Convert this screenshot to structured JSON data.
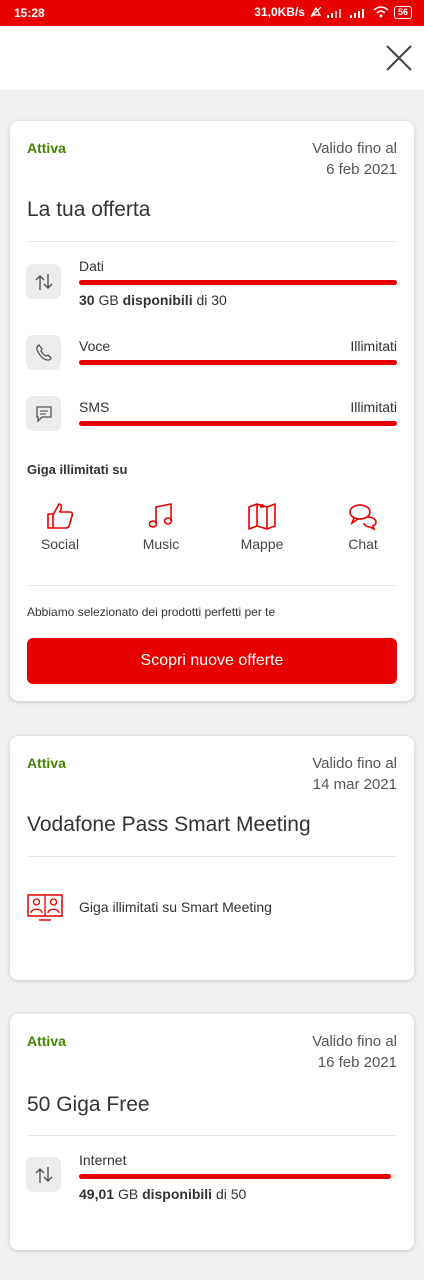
{
  "status_bar": {
    "time": "15:28",
    "speed": "31,0KB/s",
    "battery": "56"
  },
  "offers": [
    {
      "status": "Attiva",
      "valid_label": "Valido fino al",
      "valid_date": "6 feb 2021",
      "title": "La tua offerta",
      "usage": [
        {
          "label": "Dati",
          "amount": "30",
          "unit": "GB",
          "available_text": "disponibili",
          "of_text": "di 30",
          "fill_fraction": 1.0,
          "icon": "data-transfer-icon"
        },
        {
          "label": "Voce",
          "right_value": "Illimitati",
          "fill_fraction": 1.0,
          "icon": "phone-icon"
        },
        {
          "label": "SMS",
          "right_value": "Illimitati",
          "fill_fraction": 1.0,
          "icon": "message-icon"
        }
      ],
      "unlimited_title": "Giga illimitati su",
      "categories": [
        {
          "label": "Social",
          "icon": "thumbs-up-icon"
        },
        {
          "label": "Music",
          "icon": "music-note-icon"
        },
        {
          "label": "Mappe",
          "icon": "map-icon"
        },
        {
          "label": "Chat",
          "icon": "chat-bubbles-icon"
        }
      ],
      "promo_text": "Abbiamo selezionato dei prodotti perfetti per te",
      "cta_label": "Scopri nuove offerte"
    },
    {
      "status": "Attiva",
      "valid_label": "Valido fino al",
      "valid_date": "14 mar 2021",
      "title": "Vodafone Pass Smart Meeting",
      "feature": "Giga illimitati su Smart Meeting",
      "feature_icon": "video-meeting-icon"
    },
    {
      "status": "Attiva",
      "valid_label": "Valido fino al",
      "valid_date": "16 feb 2021",
      "title": "50 Giga Free",
      "usage": [
        {
          "label": "Internet",
          "amount": "49,01",
          "unit": "GB",
          "available_text": "disponibili",
          "of_text": "di 50",
          "fill_fraction": 0.98,
          "icon": "data-transfer-icon"
        }
      ]
    }
  ],
  "colors": {
    "brand_red": "#e60000",
    "status_green": "#428500",
    "background": "#f0f0f0"
  }
}
